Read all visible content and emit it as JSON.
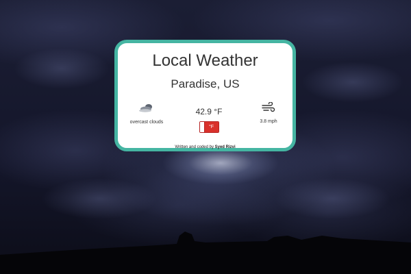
{
  "app": {
    "title": "Local Weather",
    "location": "Paradise, US"
  },
  "weather": {
    "condition": "overcast clouds",
    "condition_icon": "cloud-icon",
    "temperature": "42.9 °F",
    "unit_toggle_label": "°F",
    "wind_speed": "3.8 mph",
    "wind_icon": "wind-icon"
  },
  "footer": {
    "credit_prefix": "Written and coded by ",
    "author": "Syed Rizvi"
  },
  "colors": {
    "card_border": "#45b5a2",
    "toggle_active": "#d9312b"
  }
}
